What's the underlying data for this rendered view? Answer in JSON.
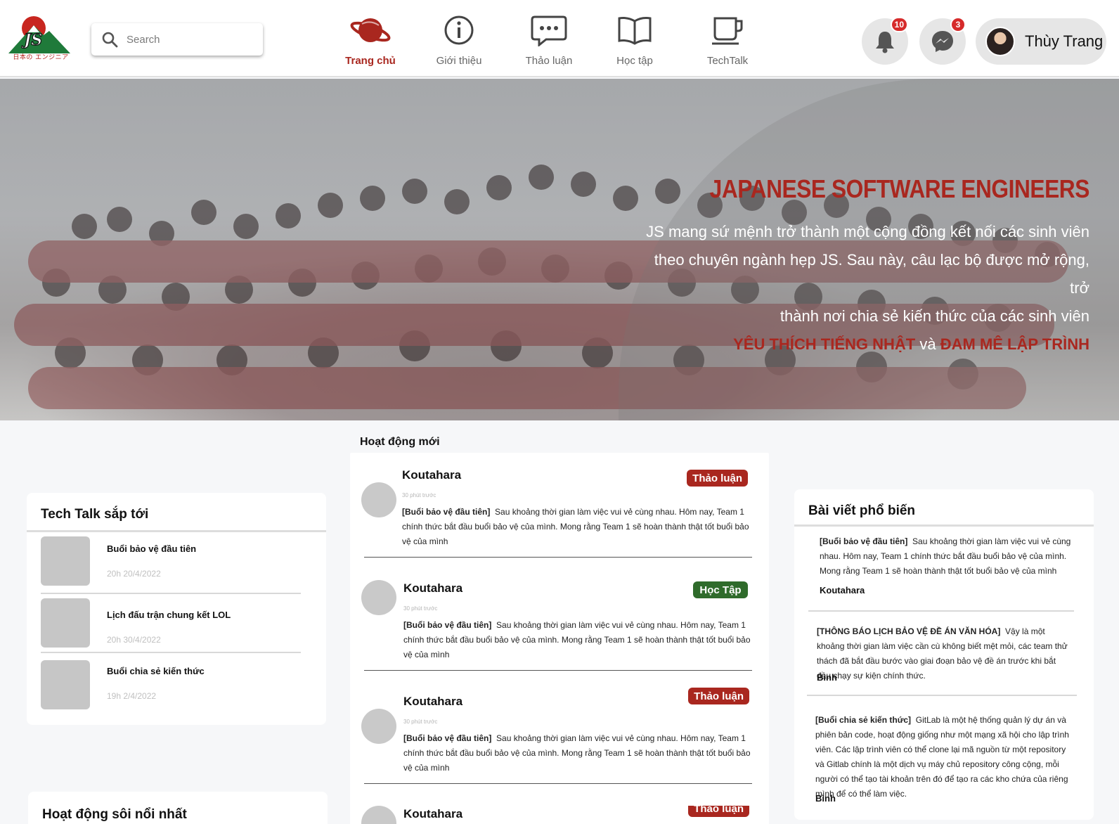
{
  "header": {
    "logo_text": "JS",
    "logo_sub": "日本の エンジニア",
    "search_placeholder": "Search",
    "nav": [
      {
        "label": "Trang chủ",
        "icon": "planet-icon",
        "active": true
      },
      {
        "label": "Giới thiệu",
        "icon": "info-icon",
        "active": false
      },
      {
        "label": "Thảo luận",
        "icon": "chat-icon",
        "active": false
      },
      {
        "label": "Học tập",
        "icon": "book-icon",
        "active": false
      },
      {
        "label": "TechTalk",
        "icon": "cup-icon",
        "active": false
      }
    ],
    "notifications_count": "10",
    "messages_count": "3",
    "user_name": "Thùy Trang"
  },
  "hero": {
    "title": "JAPANESE SOFTWARE ENGINEERS",
    "line1": "JS mang sứ mệnh trở thành một cộng đồng kết nối các sinh viên",
    "line2": "theo chuyên ngành hẹp JS. Sau này, câu lạc bộ được mở rộng, trở",
    "line3": "thành nơi chia sẻ kiến thức của các sinh viên",
    "highlight1": "YÊU THÍCH TIẾNG NHẬT",
    "connector": "và",
    "highlight2": "ĐAM MÊ LẬP TRÌNH"
  },
  "techtalk": {
    "title": "Tech Talk sắp tới",
    "items": [
      {
        "title": "Buổi bảo vệ đầu tiên",
        "date": "20h 20/4/2022"
      },
      {
        "title": "Lịch đấu trận chung kết LOL",
        "date": "20h 30/4/2022"
      },
      {
        "title": "Buổi chia sẻ kiến thức",
        "date": "19h 2/4/2022"
      }
    ]
  },
  "hot_activities": {
    "title": "Hoạt động sôi nổi nhất"
  },
  "feed": {
    "title": "Hoạt động mới",
    "posts": [
      {
        "author": "Koutahara",
        "time": "30 phút trước",
        "tag": "Thảo luận",
        "tag_color": "#a9271f",
        "bold": "[Buổi bảo vệ đầu tiên]",
        "text": "Sau khoảng thời gian làm việc vui vẻ cùng nhau. Hôm nay, Team 1 chính thức bắt đầu buổi bảo vệ của mình. Mong rằng Team 1 sẽ hoàn thành thật tốt buổi bảo vệ của mình"
      },
      {
        "author": "Koutahara",
        "time": "30 phút trước",
        "tag": "Học Tập",
        "tag_color": "#2f6b2b",
        "bold": "[Buổi bảo vệ đầu tiên]",
        "text": "Sau khoảng thời gian làm việc vui vẻ cùng nhau. Hôm nay, Team 1 chính thức bắt đầu buổi bảo vệ của mình. Mong rằng Team 1 sẽ hoàn thành thật tốt buổi bảo vệ của mình"
      },
      {
        "author": "Koutahara",
        "time": "30 phút trước",
        "tag": "Thảo luận",
        "tag_color": "#a9271f",
        "bold": "[Buổi bảo vệ đầu tiên]",
        "text": "Sau khoảng thời gian làm việc vui vẻ cùng nhau. Hôm nay, Team 1 chính thức bắt đầu buổi bảo vệ của mình. Mong rằng Team 1 sẽ hoàn thành thật tốt buổi bảo vệ của mình"
      },
      {
        "author": "Koutahara",
        "tag": "Thảo luận",
        "tag_color": "#a9271f"
      }
    ]
  },
  "popular": {
    "title": "Bài viết phổ biến",
    "items": [
      {
        "bold": "[Buổi bảo vệ đầu tiên]",
        "text": "Sau khoảng thời gian làm việc vui vẻ cùng nhau. Hôm nay, Team 1 chính thức bắt đầu buổi bảo vệ của mình. Mong rằng Team 1 sẽ hoàn thành thật tốt buổi bảo vệ của mình",
        "author": "Koutahara"
      },
      {
        "bold": "[THÔNG BÁO LỊCH BẢO VỆ ĐỀ ÁN VĂN HÓA]",
        "text": "Vậy là một khoảng thời gian làm việc cần cù không biết mệt mỏi, các team thử thách đã bắt đầu bước vào giai đoạn bảo vệ đề án trước khi bắt đầu chạy sự kiện chính thức.",
        "author": "Bình"
      },
      {
        "bold": "[Buổi chia sẻ kiến thức]",
        "text": "GitLab là một hệ thống quản lý dự án và phiên bản code, hoạt động giống như một mạng xã hội cho lập trình viên. Các lập trình viên có thể clone lại mã nguồn từ một repository và Gitlab chính là một dịch vụ máy chủ repository công cộng, mỗi người có thể tạo tài khoản trên đó để tạo ra các kho chứa của riêng mình để có thể làm việc.",
        "author": "Bình"
      }
    ]
  },
  "colors": {
    "brand": "#a9271f",
    "study": "#2f6b2b"
  }
}
